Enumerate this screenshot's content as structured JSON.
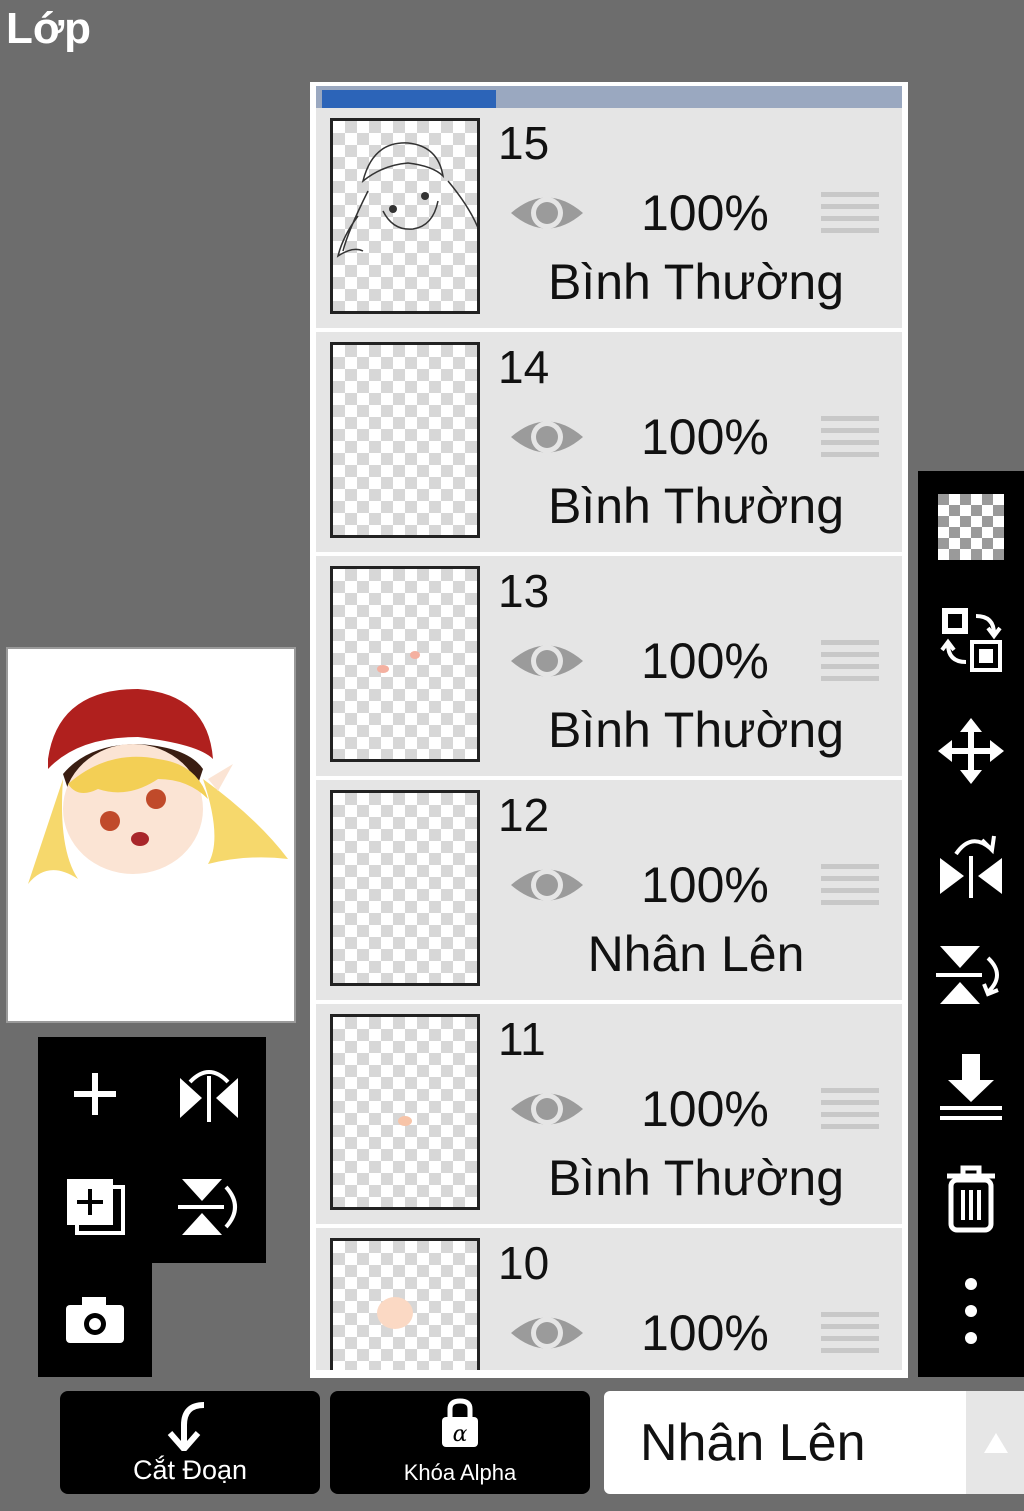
{
  "title": "Lớp",
  "layers": [
    {
      "num": "15",
      "opacity": "100%",
      "blend": "Bình Thường"
    },
    {
      "num": "14",
      "opacity": "100%",
      "blend": "Bình Thường"
    },
    {
      "num": "13",
      "opacity": "100%",
      "blend": "Bình Thường"
    },
    {
      "num": "12",
      "opacity": "100%",
      "blend": "Nhân Lên"
    },
    {
      "num": "11",
      "opacity": "100%",
      "blend": "Bình Thường"
    },
    {
      "num": "10",
      "opacity": "100%",
      "blend": ""
    }
  ],
  "bottom": {
    "clip_label": "Cắt Đoạn",
    "alpha_lock_label": "Khóa Alpha",
    "blend_mode_value": "Nhân Lên"
  },
  "colors": {
    "background": "#6d6d6d",
    "panel": "#e5e5e5",
    "toolbar": "#000000",
    "selected_tab": "#2c64b8"
  },
  "icons": {
    "left_tools": [
      "plus-icon",
      "flip-horizontal-icon",
      "add-layer-icon",
      "flip-vertical-icon",
      "camera-icon"
    ],
    "right_tools": [
      "transparency-icon",
      "swap-layers-icon",
      "move-icon",
      "flip-horizontal-rotate-icon",
      "flip-vertical-rotate-icon",
      "merge-down-icon",
      "trash-icon",
      "more-vert-icon"
    ]
  }
}
